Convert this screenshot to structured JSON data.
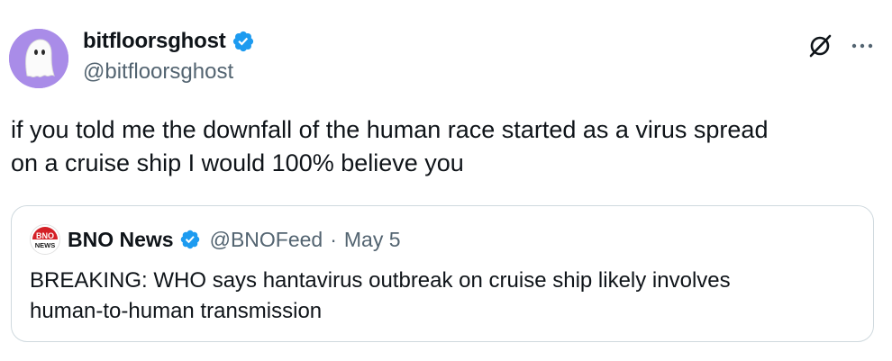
{
  "author": {
    "display_name": "bitfloorsghost",
    "handle": "@bitfloorsghost",
    "avatar_icon": "ghost-icon",
    "avatar_color": "#a98ce8",
    "verified": true
  },
  "actions": {
    "grok_icon": "grok-icon",
    "more_icon": "more-icon"
  },
  "tweet": {
    "text_line1": "if you told me the downfall of the human race started as a virus spread",
    "text_line2": "on a cruise ship I would 100% believe you"
  },
  "quoted_tweet": {
    "display_name": "BNO News",
    "handle": "@BNOFeed",
    "separator": "·",
    "date": "May 5",
    "verified": true,
    "avatar_text_top": "BNO",
    "avatar_text_bottom": "NEWS",
    "text_line1": "BREAKING: WHO says hantavirus outbreak on cruise ship likely involves",
    "text_line2": "human-to-human transmission"
  },
  "colors": {
    "verified_blue": "#1d9bf0",
    "secondary_text": "#536471",
    "border": "#cfd9de",
    "bno_red": "#d42027"
  }
}
